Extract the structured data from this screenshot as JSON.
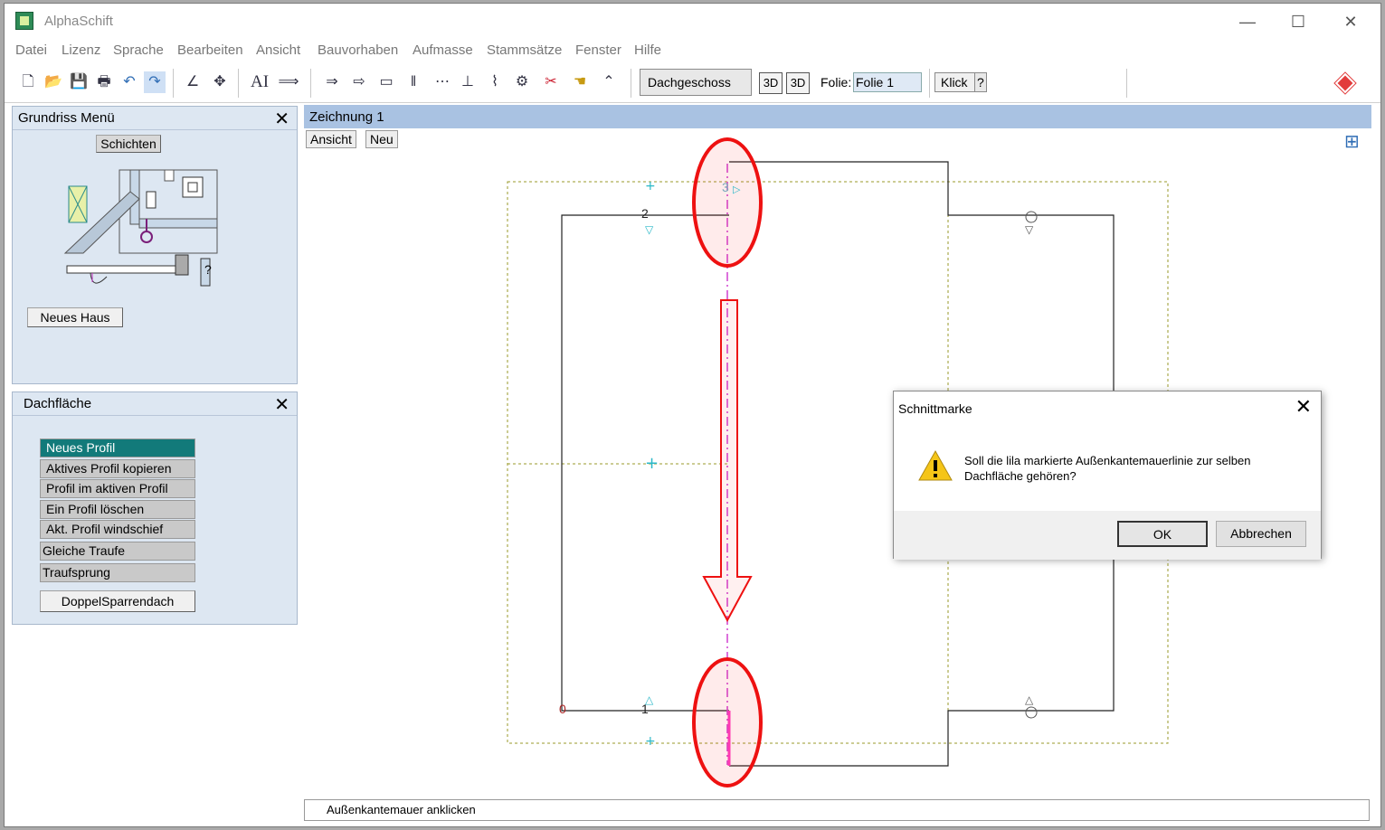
{
  "window": {
    "title": "AlphaSchift",
    "minimize": "—",
    "maximize": "☐",
    "close": "✕"
  },
  "menu": [
    "Datei",
    "Lizenz",
    "Sprache",
    "Bearbeiten",
    "Ansicht",
    "Bauvorhaben",
    "Aufmasse",
    "Stammsätze",
    "Fenster",
    "Hilfe"
  ],
  "toolbar": {
    "floor": "Dachgeschoss",
    "three_d_a": "3D",
    "three_d_b": "3D",
    "folie_label": "Folie:",
    "folie_value": "Folie 1",
    "klick": "Klick",
    "help": "?",
    "text_tool": "AI"
  },
  "grundriss": {
    "title": "Grundriss Menü",
    "close": "✕",
    "schichten": "Schichten",
    "neues_haus": "Neues Haus",
    "question": "?"
  },
  "dachflaeche": {
    "title": "Dachfläche",
    "close": "✕",
    "buttons": [
      "Neues Profil",
      "Aktives Profil kopieren",
      "Profil im aktiven Profil",
      "Ein Profil löschen",
      "Akt. Profil windschief",
      "Gleiche Traufe",
      "Traufsprung"
    ],
    "doppel": "DoppelSparrendach"
  },
  "drawing": {
    "title": "Zeichnung 1",
    "tab_ansicht": "Ansicht",
    "tab_neu": "Neu",
    "labels": {
      "n0": "0",
      "n1": "1",
      "n2": "2",
      "n3": "3"
    }
  },
  "status": {
    "text": "Außenkantemauer anklicken"
  },
  "dialog": {
    "title": "Schnittmarke",
    "close": "✕",
    "line1": "Soll die lila markierte Außenkantemauerlinie zur selben",
    "line2": "Dachfläche gehören?",
    "ok": "OK",
    "cancel": "Abbrechen"
  }
}
